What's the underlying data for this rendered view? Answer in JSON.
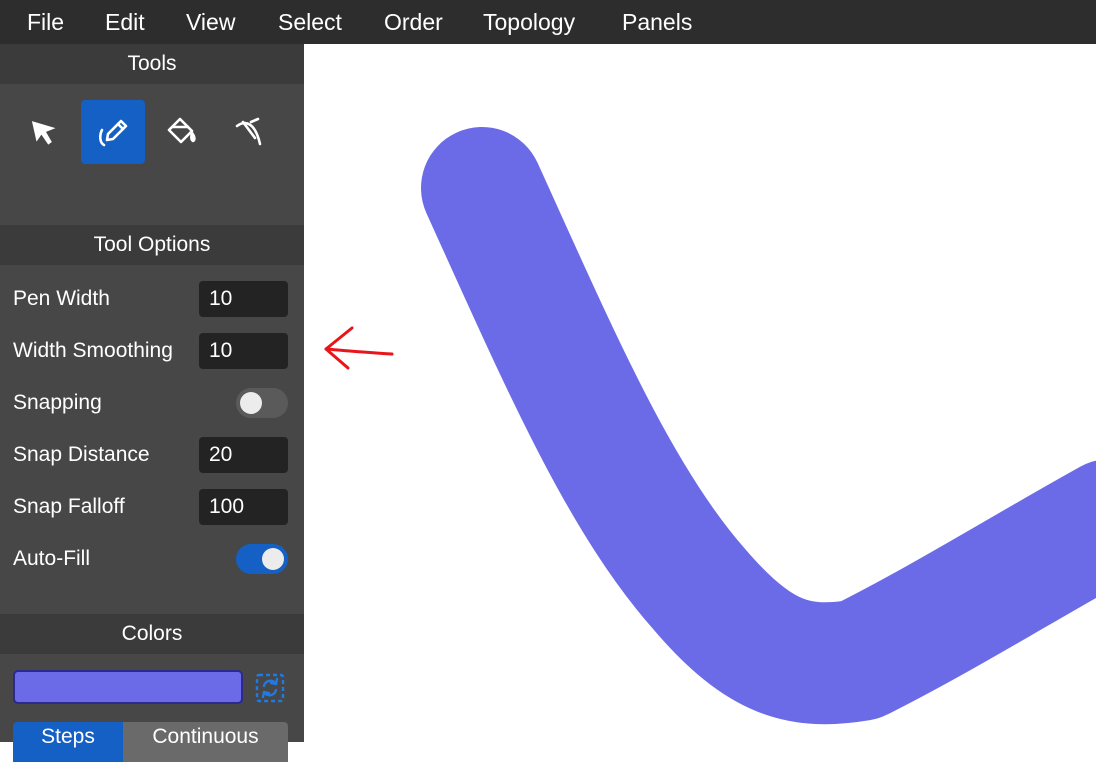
{
  "menu": [
    "File",
    "Edit",
    "View",
    "Select",
    "Order",
    "Topology",
    "Panels"
  ],
  "tools_panel": {
    "title": "Tools",
    "tools": [
      {
        "icon": "select-arrow-icon",
        "active": false
      },
      {
        "icon": "pencil-icon",
        "active": true
      },
      {
        "icon": "paint-bucket-icon",
        "active": false
      },
      {
        "icon": "curve-edit-icon",
        "active": false
      }
    ]
  },
  "tool_options": {
    "title": "Tool Options",
    "pen_width_label": "Pen Width",
    "pen_width_value": "10",
    "width_smoothing_label": "Width Smoothing",
    "width_smoothing_value": "10",
    "snapping_label": "Snapping",
    "snapping_on": false,
    "snap_distance_label": "Snap Distance",
    "snap_distance_value": "20",
    "snap_falloff_label": "Snap Falloff",
    "snap_falloff_value": "100",
    "auto_fill_label": "Auto-Fill",
    "auto_fill_on": true
  },
  "colors": {
    "title": "Colors",
    "current_color": "#6b6be8",
    "mode_steps": "Steps",
    "mode_continuous": "Continuous",
    "selected_mode": "Steps"
  },
  "theme": {
    "accent": "#1460c4",
    "stroke_color": "#6b6be8",
    "annotation_color": "#e8151b"
  }
}
